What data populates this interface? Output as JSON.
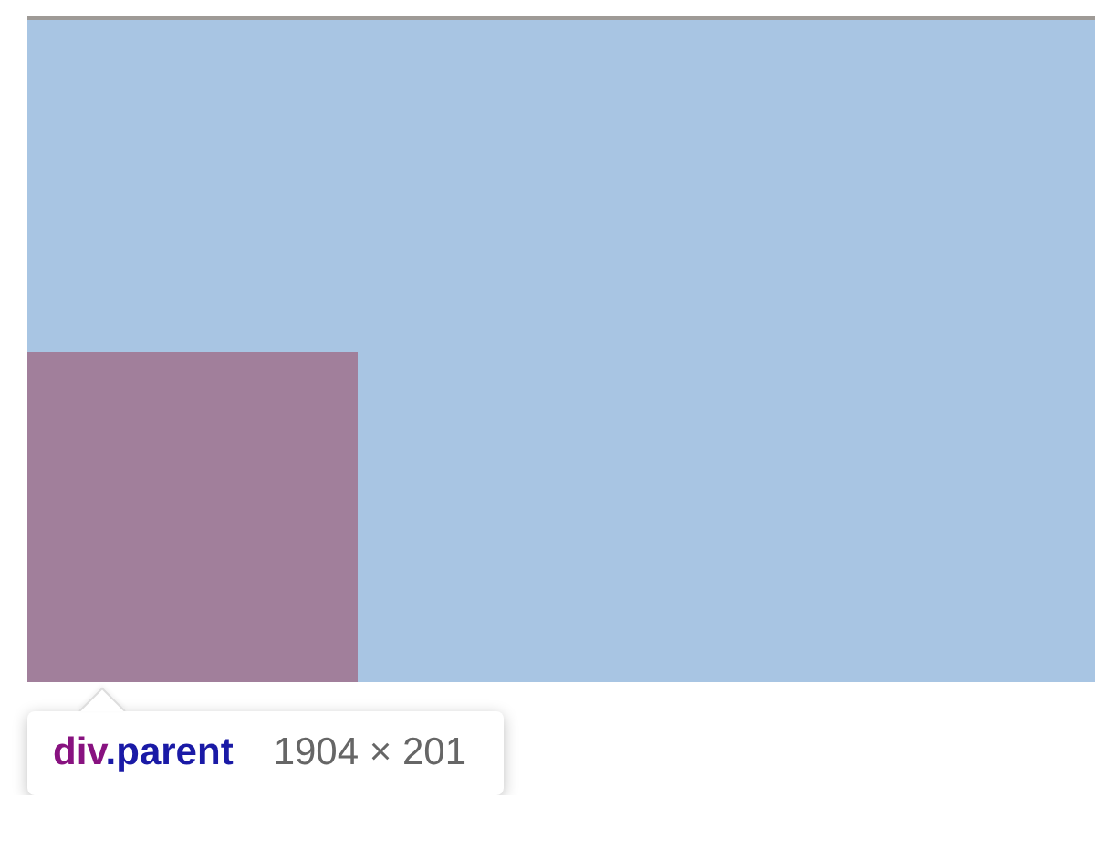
{
  "tooltip": {
    "tag": "div",
    "class_name": ".parent",
    "size": "1904 × 201"
  }
}
